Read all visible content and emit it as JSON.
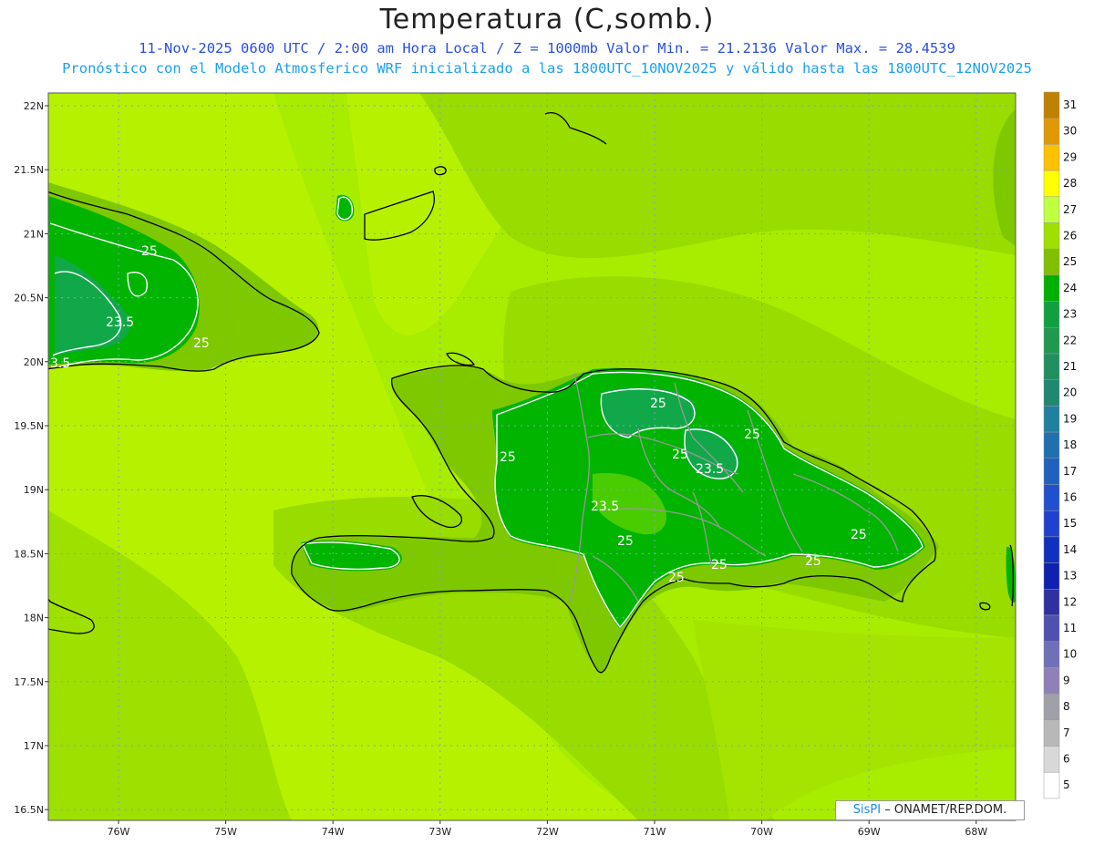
{
  "title": "Temperatura (C,somb.)",
  "subtitle_line1": "11-Nov-2025 0600 UTC / 2:00 am Hora Local / Z = 1000mb   Valor Min. = 21.2136  Valor Max. = 28.4539",
  "subtitle_line2": "Pronóstico con el Modelo Atmosferico WRF inicializado a las 1800UTC_10NOV2025 y válido hasta las  1800UTC_12NOV2025",
  "credit_brand": "SisPI",
  "credit_text": "– ONAMET/REP.DOM.",
  "lat_labels": [
    "22N",
    "21.5N",
    "21N",
    "20.5N",
    "20N",
    "19.5N",
    "19N",
    "18.5N",
    "18N",
    "17.5N",
    "17N",
    "16.5N"
  ],
  "lon_labels": [
    "76W",
    "75W",
    "74W",
    "73W",
    "72W",
    "71W",
    "70W",
    "69W",
    "68W"
  ],
  "contour_labels": [
    "25",
    "23.5",
    "25",
    "3.5",
    "25",
    "25",
    "25",
    "25",
    "23.5",
    "23.5",
    "25",
    "25",
    "25",
    "25",
    "25"
  ],
  "colorbar": {
    "levels": [
      "31",
      "30",
      "29",
      "28",
      "27",
      "26",
      "25",
      "24",
      "23",
      "22",
      "21",
      "20",
      "19",
      "18",
      "17",
      "16",
      "15",
      "14",
      "13",
      "12",
      "11",
      "10",
      "9",
      "8",
      "7",
      "6",
      "5"
    ],
    "colors": [
      "#c08000",
      "#e09a00",
      "#ffc000",
      "#ffff00",
      "#c0ff40",
      "#a0e000",
      "#80c000",
      "#00b000",
      "#10a040",
      "#209850",
      "#209060",
      "#208870",
      "#2080a0",
      "#2070b0",
      "#2060c0",
      "#2050d0",
      "#2040d0",
      "#1030c0",
      "#1020b0",
      "#3030a0",
      "#5050b0",
      "#7070b8",
      "#9080b8",
      "#a0a0a8",
      "#b8b8b8",
      "#d8d8d8",
      "#ffffff"
    ]
  }
}
